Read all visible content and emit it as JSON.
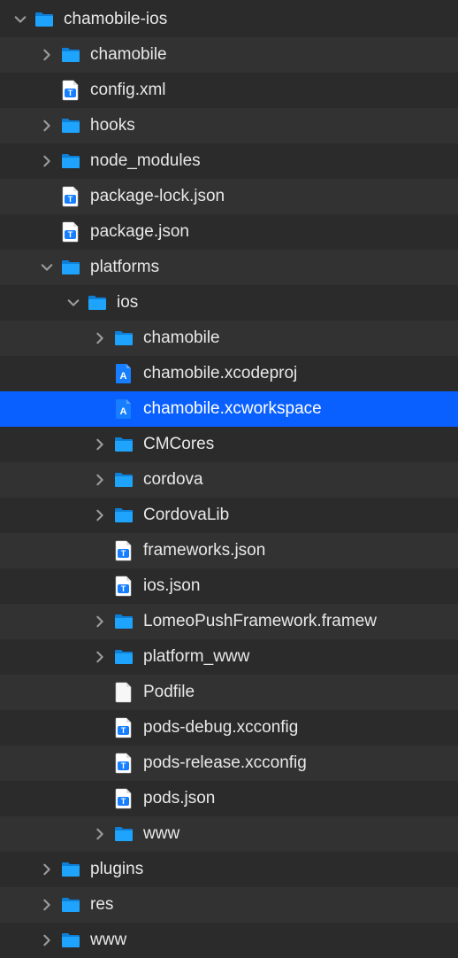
{
  "colors": {
    "bg_odd": "#2b2b2b",
    "bg_even": "#323232",
    "selection": "#0a60ff",
    "folder": "#1ea4fc",
    "chevron": "#9b9b9b",
    "text": "#e8e8e8"
  },
  "tree": [
    {
      "depth": 0,
      "kind": "folder",
      "disclosure": "down",
      "label": "chamobile-ios",
      "selected": false
    },
    {
      "depth": 1,
      "kind": "folder",
      "disclosure": "right",
      "label": "chamobile",
      "selected": false
    },
    {
      "depth": 1,
      "kind": "jsonfile",
      "disclosure": "none",
      "label": "config.xml",
      "selected": false
    },
    {
      "depth": 1,
      "kind": "folder",
      "disclosure": "right",
      "label": "hooks",
      "selected": false
    },
    {
      "depth": 1,
      "kind": "folder",
      "disclosure": "right",
      "label": "node_modules",
      "selected": false
    },
    {
      "depth": 1,
      "kind": "jsonfile",
      "disclosure": "none",
      "label": "package-lock.json",
      "selected": false
    },
    {
      "depth": 1,
      "kind": "jsonfile",
      "disclosure": "none",
      "label": "package.json",
      "selected": false
    },
    {
      "depth": 1,
      "kind": "folder",
      "disclosure": "down",
      "label": "platforms",
      "selected": false
    },
    {
      "depth": 2,
      "kind": "folder",
      "disclosure": "down",
      "label": "ios",
      "selected": false
    },
    {
      "depth": 3,
      "kind": "folder",
      "disclosure": "right",
      "label": "chamobile",
      "selected": false
    },
    {
      "depth": 3,
      "kind": "xcodeproj",
      "disclosure": "none",
      "label": "chamobile.xcodeproj",
      "selected": false
    },
    {
      "depth": 3,
      "kind": "xcodeproj",
      "disclosure": "none",
      "label": "chamobile.xcworkspace",
      "selected": true
    },
    {
      "depth": 3,
      "kind": "folder",
      "disclosure": "right",
      "label": "CMCores",
      "selected": false
    },
    {
      "depth": 3,
      "kind": "folder",
      "disclosure": "right",
      "label": "cordova",
      "selected": false
    },
    {
      "depth": 3,
      "kind": "folder",
      "disclosure": "right",
      "label": "CordovaLib",
      "selected": false
    },
    {
      "depth": 3,
      "kind": "jsonfile",
      "disclosure": "none",
      "label": "frameworks.json",
      "selected": false
    },
    {
      "depth": 3,
      "kind": "jsonfile",
      "disclosure": "none",
      "label": "ios.json",
      "selected": false
    },
    {
      "depth": 3,
      "kind": "folder",
      "disclosure": "right",
      "label": "LomeoPushFramework.framew",
      "selected": false
    },
    {
      "depth": 3,
      "kind": "folder",
      "disclosure": "right",
      "label": "platform_www",
      "selected": false
    },
    {
      "depth": 3,
      "kind": "blankfile",
      "disclosure": "none",
      "label": "Podfile",
      "selected": false
    },
    {
      "depth": 3,
      "kind": "jsonfile",
      "disclosure": "none",
      "label": "pods-debug.xcconfig",
      "selected": false
    },
    {
      "depth": 3,
      "kind": "jsonfile",
      "disclosure": "none",
      "label": "pods-release.xcconfig",
      "selected": false
    },
    {
      "depth": 3,
      "kind": "jsonfile",
      "disclosure": "none",
      "label": "pods.json",
      "selected": false
    },
    {
      "depth": 3,
      "kind": "folder",
      "disclosure": "right",
      "label": "www",
      "selected": false
    },
    {
      "depth": 1,
      "kind": "folder",
      "disclosure": "right",
      "label": "plugins",
      "selected": false
    },
    {
      "depth": 1,
      "kind": "folder",
      "disclosure": "right",
      "label": "res",
      "selected": false
    },
    {
      "depth": 1,
      "kind": "folder",
      "disclosure": "right",
      "label": "www",
      "selected": false
    }
  ]
}
